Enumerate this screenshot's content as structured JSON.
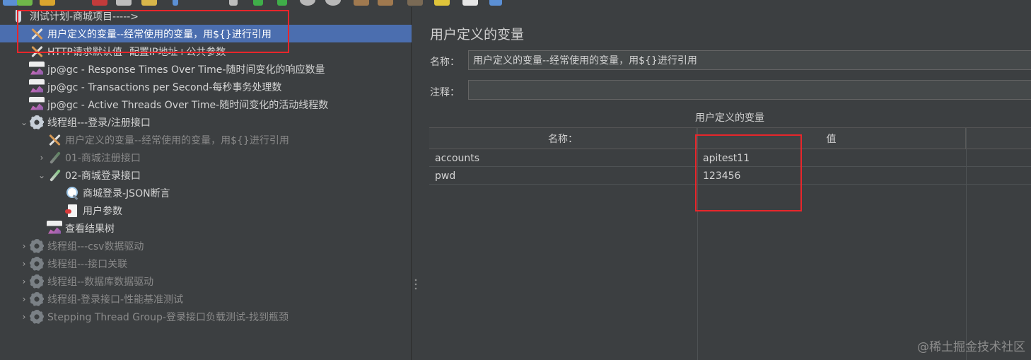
{
  "toolbar": {
    "icons": [
      "new-icon",
      "open-icon",
      "save-icon",
      "cut-icon",
      "copy-icon",
      "paste-icon",
      "add-icon",
      "wand-icon",
      "start-icon",
      "start-no-pause-icon",
      "stop-icon",
      "shutdown-icon",
      "broom-icon",
      "clear-all-icon",
      "binoculars-icon",
      "reset-search-icon",
      "function-helper-icon",
      "help-icon"
    ]
  },
  "tree": {
    "nodes": [
      {
        "label": "测试计划-商城项目----->",
        "icon": "test-plan-icon",
        "level": 0,
        "arrow": "",
        "state": "normal"
      },
      {
        "label": "用户定义的变量--经常使用的变量，用${}进行引用",
        "icon": "config-tools-icon",
        "level": 1,
        "arrow": "",
        "state": "selected"
      },
      {
        "label": "HTTP请求默认值--配置IP地址+公共参数",
        "icon": "config-tools-icon",
        "level": 1,
        "arrow": "",
        "state": "normal"
      },
      {
        "label": "jp@gc - Response Times Over Time-随时间变化的响应数量",
        "icon": "graph-listener-icon",
        "level": 1,
        "arrow": "",
        "state": "normal"
      },
      {
        "label": "jp@gc - Transactions per Second-每秒事务处理数",
        "icon": "graph-listener-icon",
        "level": 1,
        "arrow": "",
        "state": "normal"
      },
      {
        "label": "jp@gc - Active Threads Over Time-随时间变化的活动线程数",
        "icon": "graph-listener-icon",
        "level": 1,
        "arrow": "",
        "state": "normal"
      },
      {
        "label": "线程组---登录/注册接口",
        "icon": "thread-group-gear-icon",
        "level": 1,
        "arrow": "⌄",
        "state": "normal"
      },
      {
        "label": "用户定义的变量--经常使用的变量，用${}进行引用",
        "icon": "config-tools-icon",
        "level": 2,
        "arrow": "",
        "state": "disabled"
      },
      {
        "label": "01-商城注册接口",
        "icon": "http-sampler-pipette-icon",
        "level": 2,
        "arrow": "›",
        "state": "disabled"
      },
      {
        "label": "02-商城登录接口",
        "icon": "http-sampler-pipette-icon",
        "level": 2,
        "arrow": "⌄",
        "state": "normal"
      },
      {
        "label": "商城登录-JSON断言",
        "icon": "assertion-magnifier-icon",
        "level": 3,
        "arrow": "",
        "state": "normal"
      },
      {
        "label": "用户参数",
        "icon": "user-parameters-doc-icon",
        "level": 3,
        "arrow": "",
        "state": "normal"
      },
      {
        "label": "查看结果树",
        "icon": "graph-listener-icon",
        "level": 2,
        "arrow": "",
        "state": "normal"
      },
      {
        "label": "线程组---csv数据驱动",
        "icon": "thread-group-gear-icon",
        "level": 1,
        "arrow": "›",
        "state": "disabled"
      },
      {
        "label": "线程组---接口关联",
        "icon": "thread-group-gear-icon",
        "level": 1,
        "arrow": "›",
        "state": "disabled"
      },
      {
        "label": "线程组--数据库数据驱动",
        "icon": "thread-group-gear-icon",
        "level": 1,
        "arrow": "›",
        "state": "disabled"
      },
      {
        "label": "线程组-登录接口-性能基准测试",
        "icon": "thread-group-gear-icon",
        "level": 1,
        "arrow": "›",
        "state": "disabled"
      },
      {
        "label": "Stepping Thread Group-登录接口负载测试-找到瓶颈",
        "icon": "thread-group-gear-icon",
        "level": 1,
        "arrow": "›",
        "state": "disabled"
      }
    ]
  },
  "panel": {
    "title": "用户定义的变量",
    "name_label": "名称：",
    "name_value": "用户定义的变量--经常使用的变量，用${}进行引用",
    "comment_label": "注释：",
    "comment_value": "",
    "table_caption": "用户定义的变量",
    "columns": [
      "名称：",
      "值"
    ],
    "rows": [
      {
        "name": "accounts",
        "value": "apitest11"
      },
      {
        "name": "pwd",
        "value": "123456"
      }
    ]
  },
  "watermark": "@稀土掘金技术社区",
  "colors": {
    "background": "#3c3f41",
    "selection": "#4b6eaf",
    "highlight_box": "#e8262b"
  }
}
